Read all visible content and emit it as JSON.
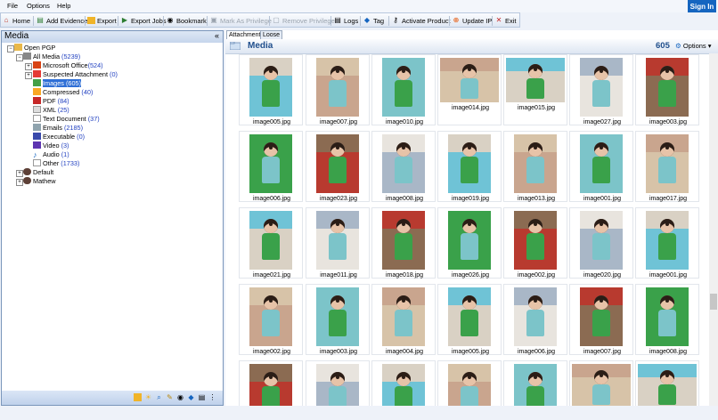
{
  "menu": {
    "file": "File",
    "options": "Options",
    "help": "Help",
    "signin": "Sign In"
  },
  "toolbar": {
    "home": "Home",
    "add_evidence": "Add Evidence",
    "export": "Export",
    "export_jobs": "Export Jobs",
    "bookmark": "Bookmark",
    "mark_privilege": "Mark As Privilege",
    "remove_privilege": "Remove Privilege",
    "logs": "Logs",
    "tag": "Tag",
    "activate": "Activate Product",
    "update_ip": "Update IP",
    "exit": "Exit"
  },
  "left_panel": {
    "title": "Media",
    "collapse": "«",
    "tree": [
      {
        "label": "Open PGP",
        "count": ""
      },
      {
        "label": "All Media",
        "count": "(5239)"
      },
      {
        "label": "Microsoft Office",
        "count": "(524)"
      },
      {
        "label": "Suspected Attachment",
        "count": "(0)"
      },
      {
        "label": "Images",
        "count": "(605)"
      },
      {
        "label": "Compressed",
        "count": "(40)"
      },
      {
        "label": "PDF",
        "count": "(84)"
      },
      {
        "label": "XML",
        "count": "(25)"
      },
      {
        "label": "Text Document",
        "count": "(37)"
      },
      {
        "label": "Emails",
        "count": "(2185)"
      },
      {
        "label": "Executable",
        "count": "(0)"
      },
      {
        "label": "Video",
        "count": "(3)"
      },
      {
        "label": "Audio",
        "count": "(1)"
      },
      {
        "label": "Other",
        "count": "(1733)"
      },
      {
        "label": "Default",
        "count": ""
      },
      {
        "label": "Mathew",
        "count": ""
      }
    ]
  },
  "right_panel": {
    "tabs": [
      "Attachment",
      "Loose Files"
    ],
    "title": "Media",
    "count": "605",
    "options": "Options"
  },
  "grid": {
    "rows": [
      [
        "image005.jpg",
        "image007.jpg",
        "image010.jpg",
        "image014.jpg",
        "image015.jpg",
        "image027.jpg",
        "image003.jpg"
      ],
      [
        "image006.jpg",
        "image023.jpg",
        "image008.jpg",
        "image019.jpg",
        "image013.jpg",
        "image001.jpg",
        "image017.jpg"
      ],
      [
        "image021.jpg",
        "image011.jpg",
        "image018.jpg",
        "image026.jpg",
        "image002.jpg",
        "image020.jpg",
        "image001.jpg"
      ],
      [
        "image002.jpg",
        "image003.jpg",
        "image004.jpg",
        "image005.jpg",
        "image006.jpg",
        "image007.jpg",
        "image008.jpg"
      ],
      [
        "",
        "",
        "",
        "",
        "",
        "",
        ""
      ]
    ]
  },
  "colors": {
    "accent": "#1565c0",
    "selection": "#2f6fd6",
    "panel_border": "#7a96bb"
  }
}
